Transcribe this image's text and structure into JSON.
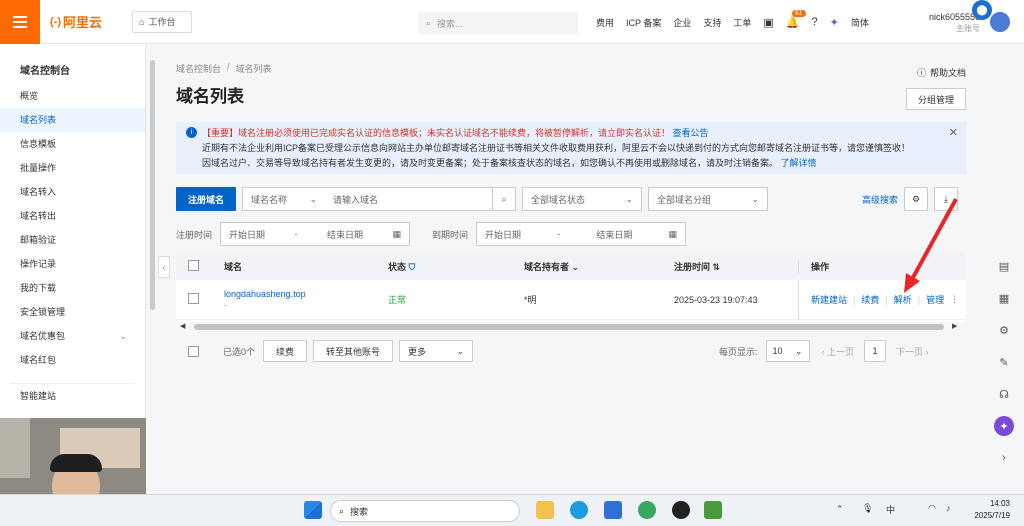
{
  "topbar": {
    "logo_symbol": "(-)",
    "logo_text": "阿里云",
    "workbench": "工作台",
    "search_placeholder": "搜索...",
    "nav": [
      "费用",
      "ICP 备案",
      "企业",
      "支持",
      "工单"
    ],
    "notification_count": "61",
    "lang": "简体",
    "user_name": "nick6055555",
    "user_sub": "主账号"
  },
  "sidebar": {
    "title": "域名控制台",
    "items": [
      "概览",
      "域名列表",
      "信息模板",
      "批量操作",
      "域名转入",
      "域名转出",
      "邮箱验证",
      "操作记录",
      "我的下载",
      "安全锁管理",
      "域名优惠包",
      "域名红包",
      "智能建站"
    ]
  },
  "main": {
    "breadcrumb": [
      "域名控制台",
      "域名列表"
    ],
    "title": "域名列表",
    "help_doc": "帮助文档",
    "group_manage": "分组管理",
    "notice": {
      "tag": "【重要】",
      "line1_warn": "域名注册必须使用已完成实名认证的信息模板；未实名认证域名不能续费，将被暂停解析，请立即实名认证！",
      "line1_link": "查看公告",
      "line2": "近期有不法企业利用ICP备案已受理公示信息向网站主办单位邮寄域名注册证书等相关文件收取费用获利，阿里云不会以快递到付的方式向您邮寄域名注册证书等，请您谨慎签收！",
      "line3": "因域名过户、交易等导致域名持有者发生变更的，请及时变更备案；处于备案核查状态的域名，如您确认不再使用或删除域名，请及时注销备案。",
      "line3_link": "了解详情"
    },
    "register_btn": "注册域名",
    "filter_type": "域名名称",
    "filter_placeholder": "请输入域名",
    "status_select": "全部域名状态",
    "group_select": "全部域名分组",
    "advanced_search": "高级搜索",
    "reg_time_label": "注册时间",
    "exp_time_label": "到期时间",
    "start_date": "开始日期",
    "end_date": "结束日期",
    "columns": [
      "域名",
      "状态",
      "域名持有者",
      "注册时间",
      "操作"
    ],
    "rows": [
      {
        "domain": "longdahuasheng.top",
        "sub": "-",
        "status": "正常",
        "holder": "*明",
        "reg_time": "2025-03-23 19:07:43",
        "actions": [
          "新建建站",
          "续费",
          "解析",
          "管理"
        ]
      }
    ],
    "selected": "已选0个",
    "renew_btn": "续费",
    "transfer_btn": "转至其他账号",
    "more_btn": "更多",
    "per_page_label": "每页显示:",
    "per_page": "10",
    "prev": "上一页",
    "page": "1",
    "next": "下一页"
  },
  "taskbar": {
    "search": "搜索",
    "ime": "中",
    "time": "14:03",
    "date": "2025/7/19"
  }
}
